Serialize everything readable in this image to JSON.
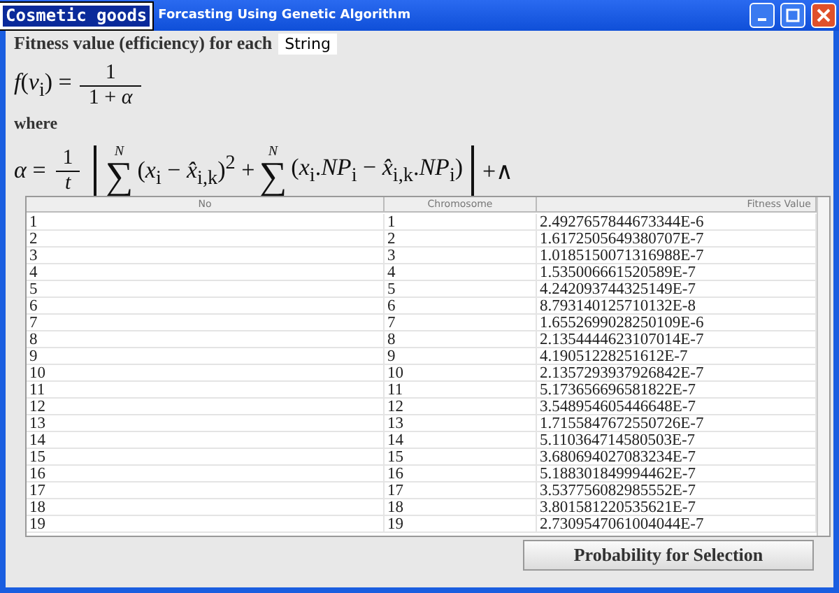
{
  "window": {
    "title_badge": "Cosmetic goods",
    "title": "Forcasting Using Genetic Algorithm"
  },
  "heading": "Fitness value (efficiency) for each",
  "tooltip": "String",
  "formula_1": {
    "lhs": "*f*(*v*$_{i}$) =",
    "numerator": "1",
    "denominator": "1 + *α*"
  },
  "where": "where",
  "formula_2": [
    {
      "kind": "text",
      "text": "*α* ="
    },
    {
      "kind": "frac",
      "numerator": "1",
      "denominator": "*t*"
    },
    {
      "kind": "bar"
    },
    {
      "kind": "sum",
      "symbol": "∑",
      "top": "*N*"
    },
    {
      "kind": "text",
      "text": "(*x*$_{i}$ − *x̂*$_{i,k}$)$^{2}$ +"
    },
    {
      "kind": "sum",
      "symbol": "∑",
      "top": "*N*"
    },
    {
      "kind": "text",
      "text": "(*x*$_{i}$.*NP*$_{i}$ − *x̂*$_{i,k}$.*NP*$_{i}$)"
    },
    {
      "kind": "bar"
    },
    {
      "kind": "text",
      "text": "+∧"
    }
  ],
  "table": {
    "columns": [
      "No",
      "Chromosome",
      "Fitness Value"
    ],
    "rows": [
      [
        "1",
        "1",
        "2.4927657844673344E-6"
      ],
      [
        "2",
        "2",
        "1.6172505649380707E-7"
      ],
      [
        "3",
        "3",
        "1.0185150071316988E-7"
      ],
      [
        "4",
        "4",
        "1.535006661520589E-7"
      ],
      [
        "5",
        "5",
        "4.242093744325149E-7"
      ],
      [
        "6",
        "6",
        "8.793140125710132E-8"
      ],
      [
        "7",
        "7",
        "1.6552699028250109E-6"
      ],
      [
        "8",
        "8",
        "2.1354444623107014E-7"
      ],
      [
        "9",
        "9",
        "4.19051228251612E-7"
      ],
      [
        "10",
        "10",
        "2.1357293937926842E-7"
      ],
      [
        "11",
        "11",
        "5.173656696581822E-7"
      ],
      [
        "12",
        "12",
        "3.548954605446648E-7"
      ],
      [
        "13",
        "13",
        "1.7155847672550726E-7"
      ],
      [
        "14",
        "14",
        "5.110364714580503E-7"
      ],
      [
        "15",
        "15",
        "3.680694027083234E-7"
      ],
      [
        "16",
        "16",
        "5.188301849994462E-7"
      ],
      [
        "17",
        "17",
        "3.537756082985552E-7"
      ],
      [
        "18",
        "18",
        "3.801581220535621E-7"
      ],
      [
        "19",
        "19",
        "2.7309547061004044E-7"
      ]
    ]
  },
  "button": "Probability for Selection"
}
